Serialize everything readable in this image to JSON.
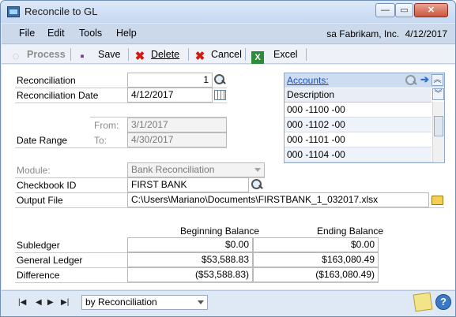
{
  "window": {
    "title": "Reconcile to GL"
  },
  "menubar": {
    "items": [
      "File",
      "Edit",
      "Tools",
      "Help"
    ],
    "user": "sa",
    "company": "Fabrikam, Inc.",
    "date": "4/12/2017"
  },
  "toolbar": {
    "process": "Process",
    "save": "Save",
    "delete": "Delete",
    "cancel": "Cancel",
    "excel": "Excel"
  },
  "form": {
    "reconciliation_label": "Reconciliation",
    "reconciliation_value": "1",
    "recon_date_label": "Reconciliation Date",
    "recon_date_value": "4/12/2017",
    "date_range_label": "Date Range",
    "from_label": "From:",
    "from_value": "3/1/2017",
    "to_label": "To:",
    "to_value": "4/30/2017",
    "module_label": "Module:",
    "module_value": "Bank Reconciliation",
    "checkbook_label": "Checkbook ID",
    "checkbook_value": "FIRST BANK",
    "output_label": "Output File",
    "output_value": "C:\\Users\\Mariano\\Documents\\FIRSTBANK_1_032017.xlsx"
  },
  "accounts": {
    "link": "Accounts:",
    "column": "Description",
    "rows": [
      "000 -1100 -00",
      "000 -1102 -00",
      "000 -1101 -00",
      "000 -1104 -00"
    ]
  },
  "balances": {
    "beginning_header": "Beginning Balance",
    "ending_header": "Ending Balance",
    "rows": [
      {
        "label": "Subledger",
        "beginning": "$0.00",
        "ending": "$0.00"
      },
      {
        "label": "General Ledger",
        "beginning": "$53,588.83",
        "ending": "$163,080.49"
      },
      {
        "label": "Difference",
        "beginning": "($53,588.83)",
        "ending": "($163,080.49)"
      }
    ]
  },
  "status": {
    "sort_value": "by Reconciliation",
    "nav": [
      "|◀",
      "◀",
      "▶",
      "▶|"
    ]
  },
  "icons": {
    "app": "app-window-icon",
    "process": "process-icon",
    "save": "floppy-disk-icon",
    "delete": "red-x-icon",
    "cancel": "red-x-icon",
    "excel": "excel-icon",
    "lookup": "magnifier-icon",
    "calendar": "calendar-icon",
    "folder": "folder-icon",
    "note": "note-icon",
    "help": "help-icon"
  }
}
